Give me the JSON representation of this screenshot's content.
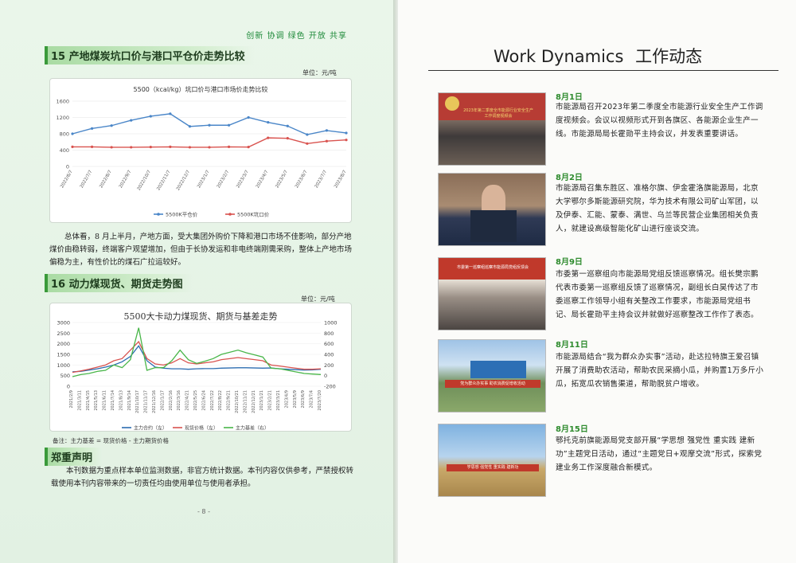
{
  "left_page": {
    "slogan": "创新 协调 绿色 开放 共享",
    "section15_title": "15 产地煤炭坑口价与港口平仓价走势比较",
    "section15_unit": "单位：元/吨",
    "section15_paragraph": "总体看，8 月上半月，产地方面，受大集团外购价下降和港口市场不佳影响，部分产地煤价由稳转弱，终端客户观望增加，但由于长协发运和非电终端刚需采购，整体上产地市场偏稳为主，有性价比的煤石广拉运较好。",
    "section16_title": "16 动力煤现货、期货走势图",
    "section16_unit": "单位：元/吨",
    "note": "备注：主力基差 = 现货价格 - 主力期货价格",
    "disclaimer_title": "郑重声明",
    "disclaimer": "本刊数据为重点样本单位监测数据，非官方统计数据。本刊内容仅供参考，严禁授权转载使用本刊内容带来的一切责任均由使用单位与使用者承担。",
    "page_number": "- 8 -"
  },
  "chart_data": [
    {
      "type": "line",
      "title": "5500（kcal/kg）坑口价与港口市场价走势比较",
      "categories": [
        "2022/6/7",
        "2022/7/7",
        "2022/8/7",
        "2022/9/7",
        "2022/10/7",
        "2022/11/7",
        "2022/12/7",
        "2023/1/7",
        "2023/2/7",
        "2023/3/7",
        "2023/4/7",
        "2023/5/7",
        "2023/6/7",
        "2023/7/7",
        "2023/8/7"
      ],
      "ylim": [
        0,
        1600
      ],
      "yticks": [
        0,
        400,
        800,
        1200,
        1600
      ],
      "series": [
        {
          "name": "5500K平仓价",
          "color": "#4a86c8",
          "values": [
            800,
            930,
            1000,
            1130,
            1230,
            1290,
            980,
            1010,
            1010,
            1200,
            1080,
            990,
            780,
            880,
            820
          ]
        },
        {
          "name": "5500K坑口价",
          "color": "#d9534f",
          "values": [
            480,
            480,
            470,
            470,
            475,
            480,
            470,
            470,
            480,
            475,
            700,
            690,
            560,
            620,
            650
          ]
        }
      ]
    },
    {
      "type": "line",
      "title": "5500大卡动力煤现货、期货与基差走势",
      "categories": [
        "2021/2/9",
        "2021/3/11",
        "2021/4/15",
        "2021/5/13",
        "2021/6/11",
        "2021/7/14",
        "2021/8/13",
        "2021/9/14",
        "2021/10/17",
        "2021/11/17",
        "2021/12/16",
        "2022/1/17",
        "2022/2/16",
        "2022/3/16",
        "2022/4/21",
        "2022/5/25",
        "2022/6/24",
        "2022/7/22",
        "2022/8/22",
        "2022/9/21",
        "2022/10/21",
        "2022/11/21",
        "2022/12/21",
        "2023/1/21",
        "2023/2/21",
        "2023/3/21",
        "2023/4/9",
        "2023/5/9",
        "2023/6/9",
        "2023/7/4",
        "2023/7/20"
      ],
      "y_left": [
        0,
        500,
        1000,
        1500,
        2000,
        2500,
        3000
      ],
      "y_right": [
        -200,
        0,
        200,
        400,
        600,
        800,
        1000
      ],
      "series": [
        {
          "name": "主力合约（左）",
          "color": "#2b6cb0",
          "axis": "left",
          "values": [
            680,
            700,
            760,
            820,
            900,
            1000,
            1150,
            1400,
            1900,
            1200,
            900,
            850,
            820,
            820,
            800,
            820,
            830,
            830,
            850,
            860,
            870,
            870,
            860,
            850,
            860,
            820,
            800,
            780,
            760,
            770,
            800
          ]
        },
        {
          "name": "现货价格（左）",
          "color": "#d9534f",
          "axis": "left",
          "values": [
            650,
            720,
            800,
            900,
            1000,
            1200,
            1300,
            1700,
            2100,
            1300,
            1050,
            1000,
            1100,
            1300,
            1100,
            1050,
            1100,
            1150,
            1250,
            1300,
            1350,
            1300,
            1250,
            1200,
            1000,
            950,
            900,
            850,
            800,
            800,
            820
          ]
        },
        {
          "name": "主力基差（右）",
          "color": "#49b649",
          "axis": "right",
          "values": [
            -20,
            20,
            40,
            80,
            100,
            200,
            150,
            300,
            900,
            100,
            150,
            150,
            280,
            480,
            300,
            230,
            270,
            320,
            400,
            440,
            480,
            430,
            390,
            350,
            140,
            130,
            100,
            70,
            40,
            30,
            20
          ]
        }
      ]
    }
  ],
  "right_page": {
    "title_en": "Work Dynamics",
    "title_cn": "工作动态",
    "items": [
      {
        "date": "8月1日",
        "text": "市能源局召开2023年第二季度全市能源行业安全生产工作调度视频会。会议以视频形式开到各旗区、各能源企业生产一线。市能源局局长霍勋平主持会议，并发表重要讲话。",
        "photo_banner": "2023年第二季度全市能源行业安全生产工作调度视频会"
      },
      {
        "date": "8月2日",
        "text": "市能源局召集东胜区、准格尔旗、伊金霍洛旗能源局，北京大学鄂尔多斯能源研究院，华为技术有限公司矿山军团，以及伊泰、汇能、蒙泰、满世、乌兰等民营企业集团相关负责人，就建设高级智能化矿山进行座谈交流。",
        "photo_banner": ""
      },
      {
        "date": "8月9日",
        "text": "市委第一巡察组向市能源局党组反馈巡察情况。组长樊宗鹏代表市委第一巡察组反馈了巡察情况，副组长白昊传达了市委巡察工作领导小组有关整改工作要求，市能源局党组书记、局长霍勋平主持会议并就做好巡察整改工作作了表态。",
        "photo_banner": "市委第一巡察组巡察市能源局党组反馈会"
      },
      {
        "date": "8月11日",
        "text": "市能源局结合“我为群众办实事”活动，赴达拉特旗王爱召镇开展了消费助农活动，帮助农民采摘小瓜，并购置1万多斤小瓜，拓宽瓜农销售渠道，帮助脱贫户增收。",
        "photo_banner": "党为群众办实事 助农消费促增收活动"
      },
      {
        "date": "8月15日",
        "text": "鄂托克前旗能源局党支部开展“学思想 强党性 重实践 建新功”主题党日活动，通过“主题党日+观摩交流”形式，探索党建业务工作深度融合新模式。",
        "photo_banner": "学思想 强党性 重实践 建新功"
      }
    ]
  }
}
